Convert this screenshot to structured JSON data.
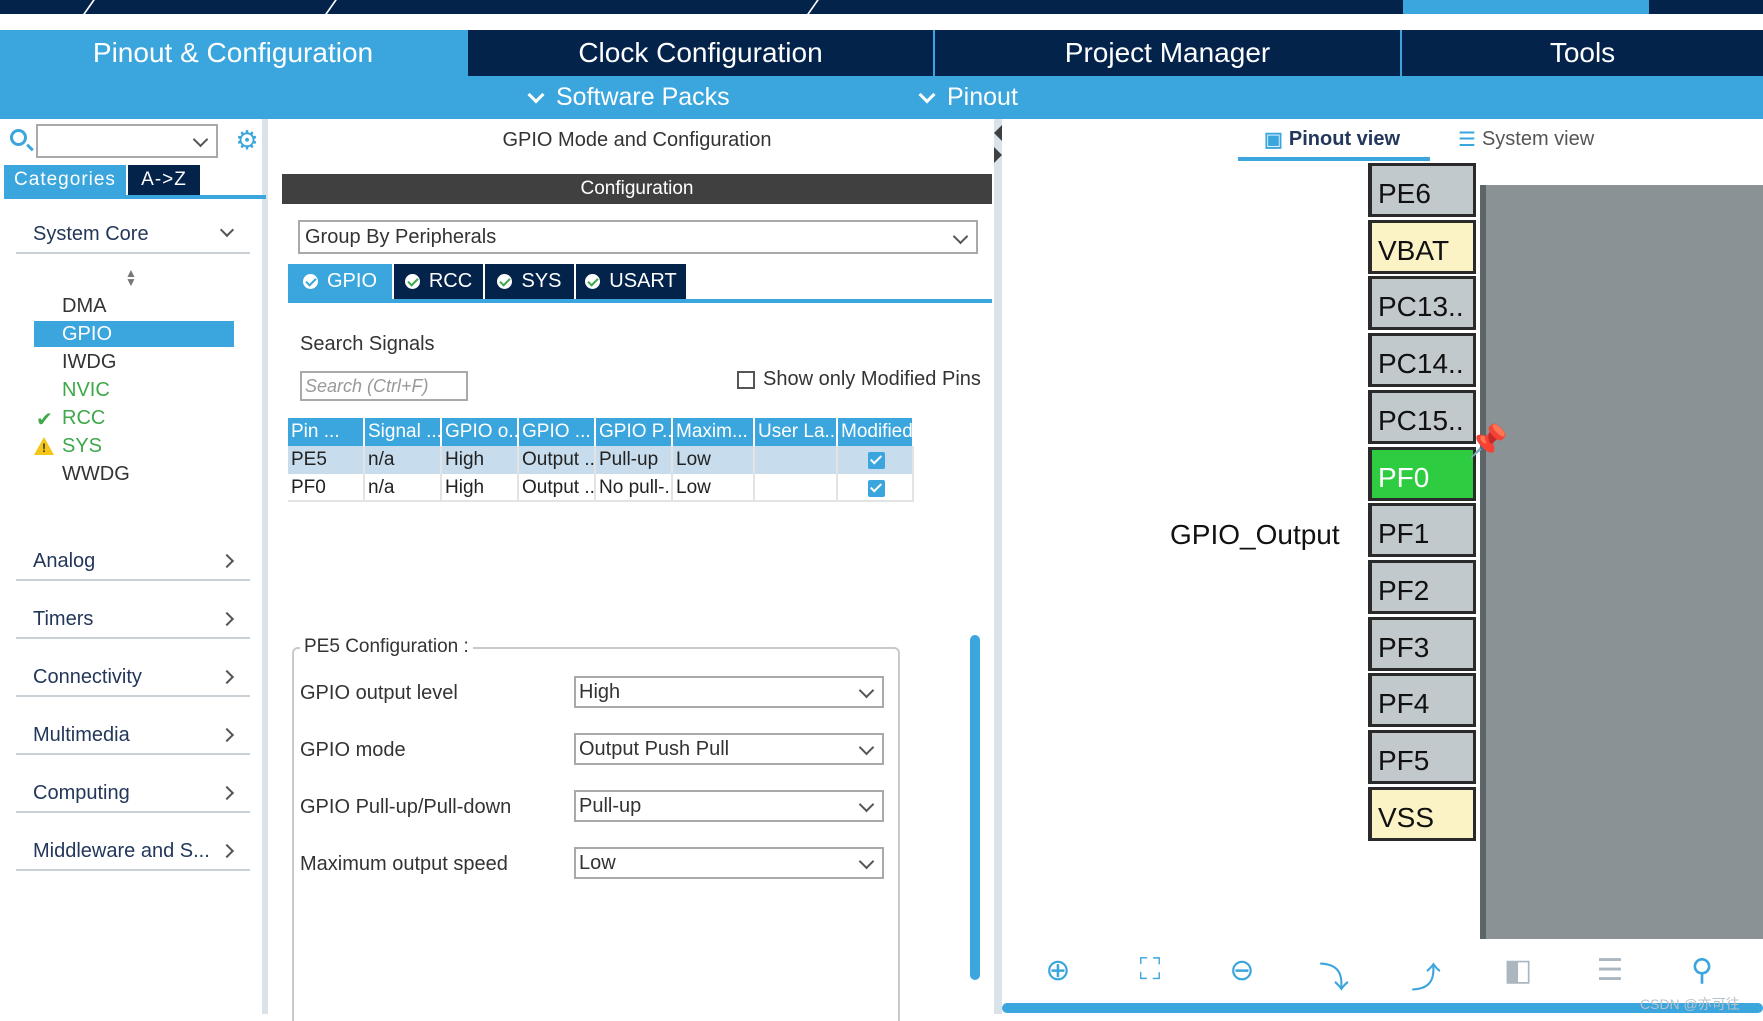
{
  "header": {
    "main_tabs": [
      {
        "label": "Pinout & Configuration",
        "active": true
      },
      {
        "label": "Clock Configuration",
        "active": false
      },
      {
        "label": "Project Manager",
        "active": false
      },
      {
        "label": "Tools",
        "active": false
      }
    ],
    "sub_menu": [
      {
        "label": "Software Packs"
      },
      {
        "label": "Pinout"
      }
    ]
  },
  "left": {
    "category_tabs": [
      "Categories",
      "A->Z"
    ],
    "system_core": {
      "title": "System Core",
      "items": [
        {
          "label": "DMA",
          "state": "normal"
        },
        {
          "label": "GPIO",
          "state": "selected"
        },
        {
          "label": "IWDG",
          "state": "normal"
        },
        {
          "label": "NVIC",
          "state": "green"
        },
        {
          "label": "RCC",
          "state": "ok"
        },
        {
          "label": "SYS",
          "state": "warning"
        },
        {
          "label": "WWDG",
          "state": "normal"
        }
      ]
    },
    "sections": [
      "Analog",
      "Timers",
      "Connectivity",
      "Multimedia",
      "Computing",
      "Middleware and S..."
    ]
  },
  "center": {
    "title": "GPIO Mode and Configuration",
    "config_header": "Configuration",
    "group_by": "Group By Peripherals",
    "peripheral_tabs": [
      {
        "label": "GPIO",
        "active": true
      },
      {
        "label": "RCC",
        "active": false
      },
      {
        "label": "SYS",
        "active": false
      },
      {
        "label": "USART",
        "active": false
      }
    ],
    "search_signals_label": "Search Signals",
    "search_placeholder": "Search (Ctrl+F)",
    "show_modified_label": "Show only Modified Pins",
    "table": {
      "headers": [
        "Pin ...",
        "Signal ...",
        "GPIO o...",
        "GPIO ...",
        "GPIO P...",
        "Maxim...",
        "User La...",
        "Modified"
      ],
      "rows": [
        [
          "PE5",
          "n/a",
          "High",
          "Output ...",
          "Pull-up",
          "Low",
          "",
          "checked"
        ],
        [
          "PF0",
          "n/a",
          "High",
          "Output ...",
          "No pull-...",
          "Low",
          "",
          "checked"
        ]
      ]
    },
    "pe5_config": {
      "title": "PE5 Configuration :",
      "fields": [
        {
          "label": "GPIO output level",
          "value": "High"
        },
        {
          "label": "GPIO mode",
          "value": "Output Push Pull"
        },
        {
          "label": "GPIO Pull-up/Pull-down",
          "value": "Pull-up"
        },
        {
          "label": "Maximum output speed",
          "value": "Low"
        }
      ]
    }
  },
  "right": {
    "view_tabs": [
      {
        "label": "Pinout view",
        "active": true
      },
      {
        "label": "System view",
        "active": false
      }
    ],
    "pins": [
      {
        "label": "PE6",
        "kind": "normal"
      },
      {
        "label": "VBAT",
        "kind": "power"
      },
      {
        "label": "PC13..",
        "kind": "normal"
      },
      {
        "label": "PC14..",
        "kind": "normal"
      },
      {
        "label": "PC15..",
        "kind": "normal"
      },
      {
        "label": "PF0",
        "kind": "active"
      },
      {
        "label": "PF1",
        "kind": "normal"
      },
      {
        "label": "PF2",
        "kind": "normal"
      },
      {
        "label": "PF3",
        "kind": "normal"
      },
      {
        "label": "PF4",
        "kind": "normal"
      },
      {
        "label": "PF5",
        "kind": "normal"
      },
      {
        "label": "VSS",
        "kind": "power"
      }
    ],
    "pin_signal_label": "GPIO_Output",
    "tools": [
      "zoom-in-icon",
      "fit-icon",
      "zoom-out-icon",
      "rotate-right-icon",
      "rotate-left-icon",
      "flip-vertical-icon",
      "flip-horizontal-icon",
      "search-icon"
    ]
  },
  "watermark": "CSDN @亦可往",
  "colors": {
    "navy": "#03234b",
    "accent_blue": "#3ba6dd",
    "pin_active_green": "#2ecc40",
    "pin_power_yellow": "#fbf3c6",
    "pin_gray": "#c2c9cd"
  }
}
